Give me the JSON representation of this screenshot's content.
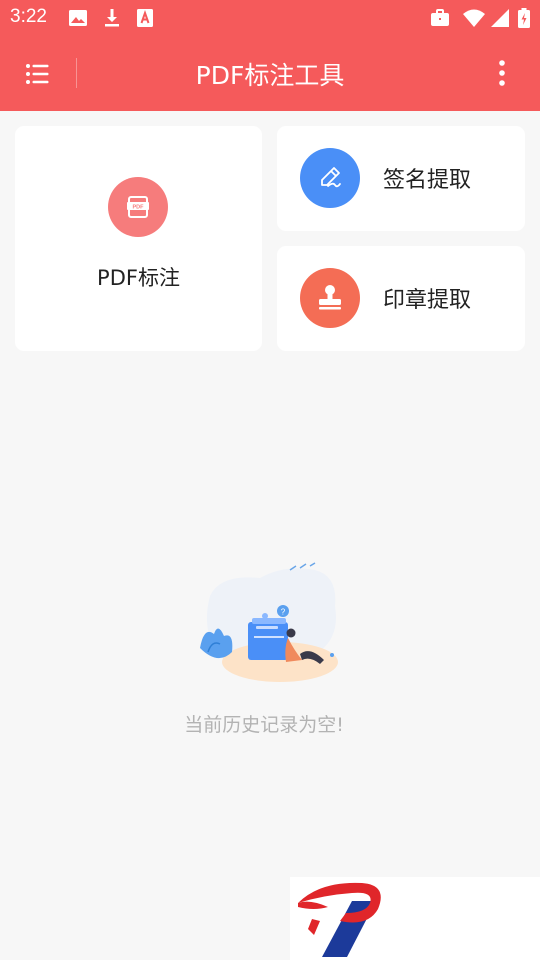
{
  "status_bar": {
    "time": "3:22",
    "left_icons": [
      "image-icon",
      "download-icon",
      "font-icon"
    ],
    "right_icons": [
      "briefcase-icon",
      "wifi-icon",
      "signal-icon",
      "battery-icon"
    ]
  },
  "app_bar": {
    "title": "PDF标注工具",
    "menu_icon": "list-menu-icon",
    "more_icon": "more-vert-icon",
    "background_color": "#f55a5b"
  },
  "features": {
    "pdf_annotate": {
      "label": "PDF标注",
      "icon": "pdf-document-icon",
      "color": "#f67c7c"
    },
    "signature_extract": {
      "label": "签名提取",
      "icon": "pen-signature-icon",
      "color": "#4a8ff7"
    },
    "seal_extract": {
      "label": "印章提取",
      "icon": "stamp-icon",
      "color": "#f46d55"
    }
  },
  "history": {
    "empty_message": "当前历史记录为空!",
    "illustration": "empty-folder-illustration"
  },
  "ad": {
    "logo": "red-blue-p-logo"
  }
}
